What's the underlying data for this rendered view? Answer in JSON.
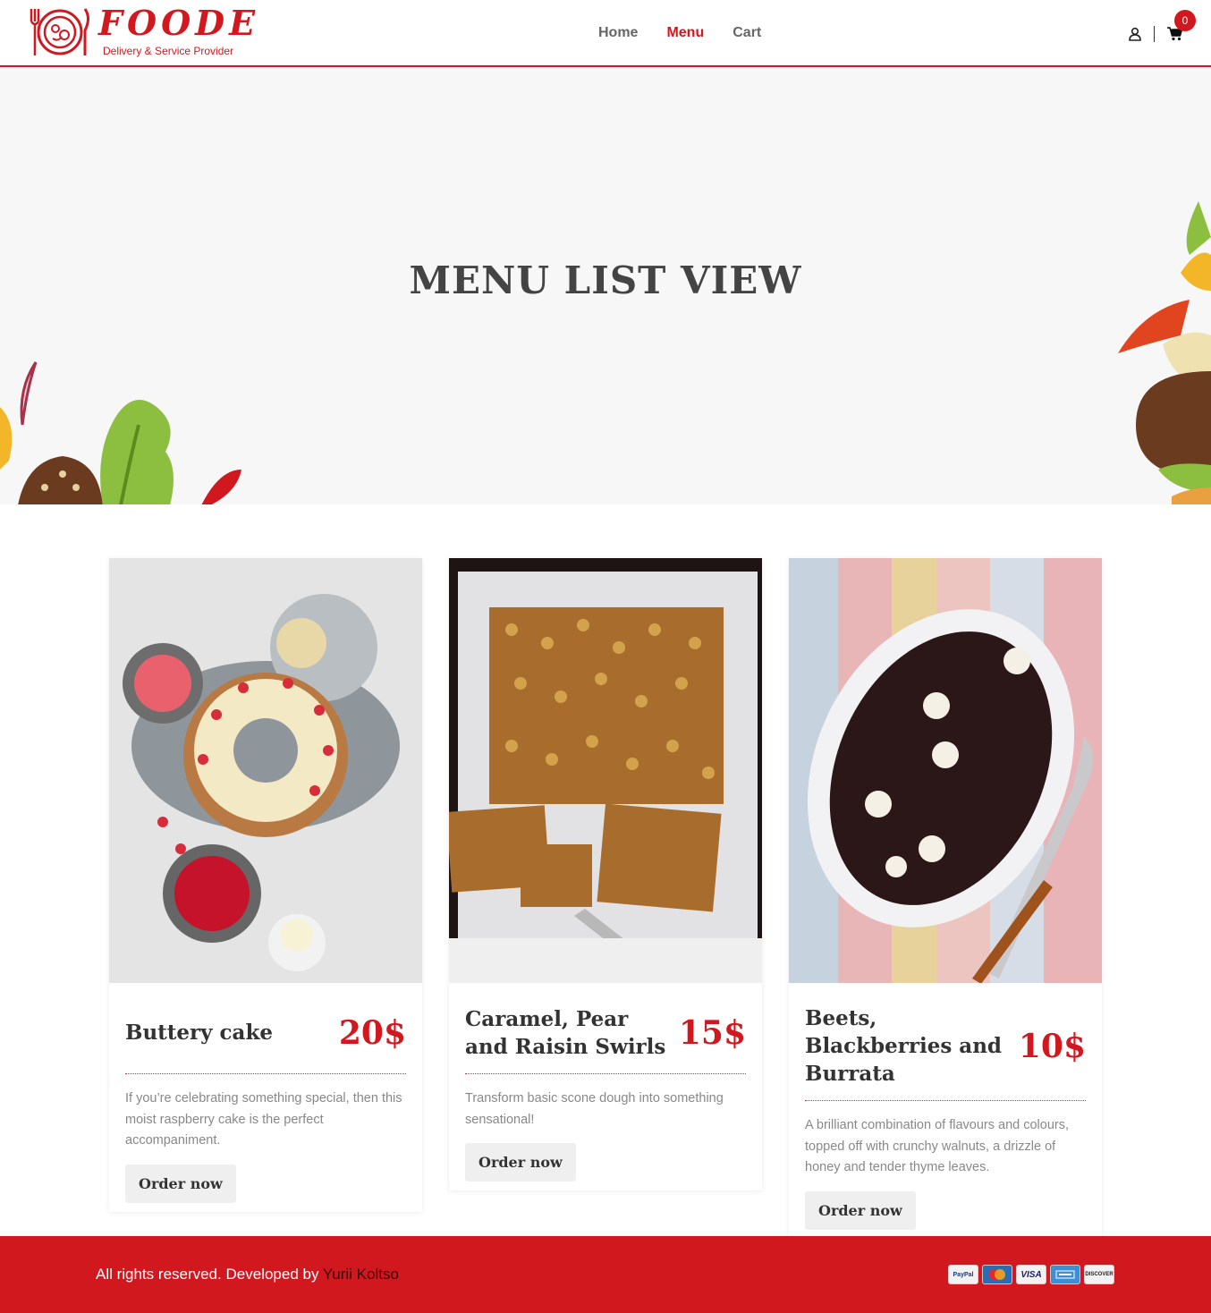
{
  "brand": {
    "name": "FOODE",
    "tagline": "Delivery & Service Provider",
    "color": "#d1181f"
  },
  "nav": {
    "items": [
      {
        "label": "Home",
        "active": false
      },
      {
        "label": "Menu",
        "active": true
      },
      {
        "label": "Cart",
        "active": false
      }
    ]
  },
  "header_icons": {
    "user": "user-icon",
    "cart": "cart-icon",
    "cart_count": "0"
  },
  "hero": {
    "title": "MENU LIST VIEW"
  },
  "menu": {
    "items": [
      {
        "name": "Buttery cake",
        "price": "20$",
        "description": "If you’re celebrating something special, then this moist raspberry cake is the perfect accompaniment.",
        "button": "Order now"
      },
      {
        "name": "Caramel, Pear and Raisin Swirls",
        "price": "15$",
        "description": "Transform basic scone dough into something sensational!",
        "button": "Order now"
      },
      {
        "name": "Beets, Blackberries and Burrata",
        "price": "10$",
        "description": "A brilliant combination of flavours and colours, topped off with crunchy walnuts, a drizzle of honey and tender thyme leaves.",
        "button": "Order now"
      }
    ]
  },
  "footer": {
    "text": "All rights reserved. Developed by",
    "author": "Yurii Koltso",
    "payments": [
      "PayPal",
      "MasterCard",
      "VISA",
      "American Express",
      "DISCOVER"
    ]
  }
}
